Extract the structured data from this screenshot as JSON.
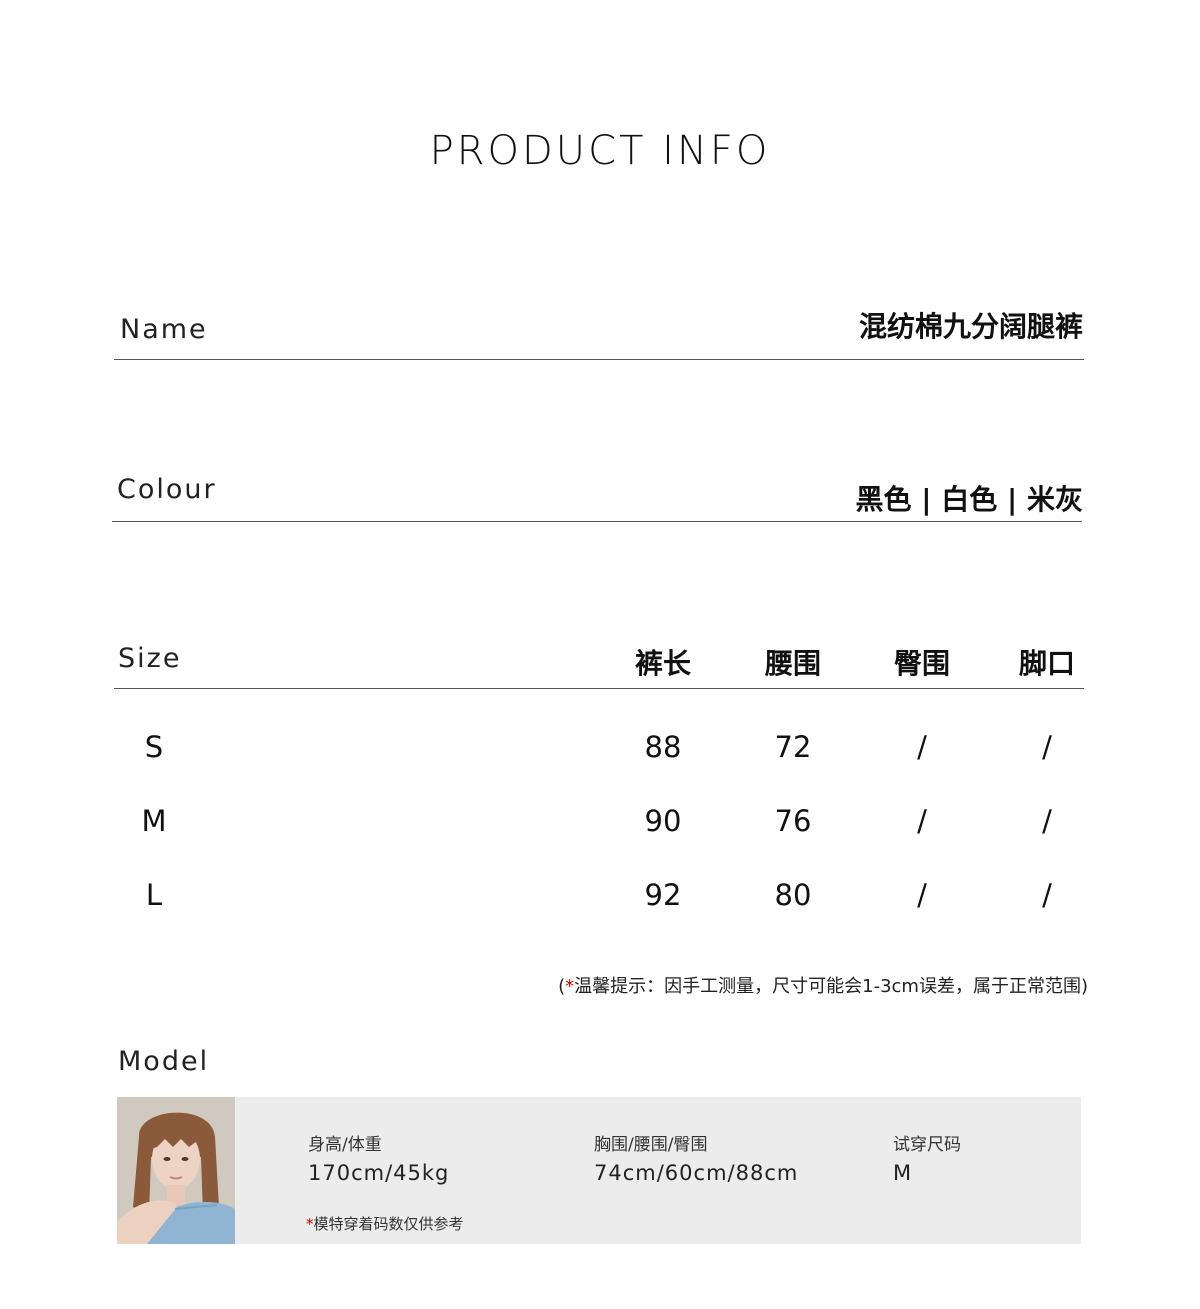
{
  "title": "PRODUCT INFO",
  "name": {
    "label": "Name",
    "value": "混纺棉九分阔腿裤"
  },
  "colour": {
    "label": "Colour",
    "value": "黑色 | 白色 | 米灰"
  },
  "size": {
    "label": "Size",
    "headers": [
      "裤长",
      "腰围",
      "臀围",
      "脚口"
    ],
    "rows": [
      {
        "size": "S",
        "values": [
          "88",
          "72",
          "/",
          "/"
        ]
      },
      {
        "size": "M",
        "values": [
          "90",
          "76",
          "/",
          "/"
        ]
      },
      {
        "size": "L",
        "values": [
          "92",
          "80",
          "/",
          "/"
        ]
      }
    ]
  },
  "note": {
    "open": "(",
    "star": "*",
    "text": "温馨提示：因手工测量，尺寸可能会1-3cm误差，属于正常范围)"
  },
  "model": {
    "label": "Model",
    "height_weight_label": "身高/体重",
    "height_weight_value": "170cm/45kg",
    "measure_label": "胸围/腰围/臀围",
    "measure_value": "74cm/60cm/88cm",
    "fit_label": "试穿尺码",
    "fit_value": "M",
    "note_star": "*",
    "note_text": "模特穿着码数仅供参考"
  }
}
